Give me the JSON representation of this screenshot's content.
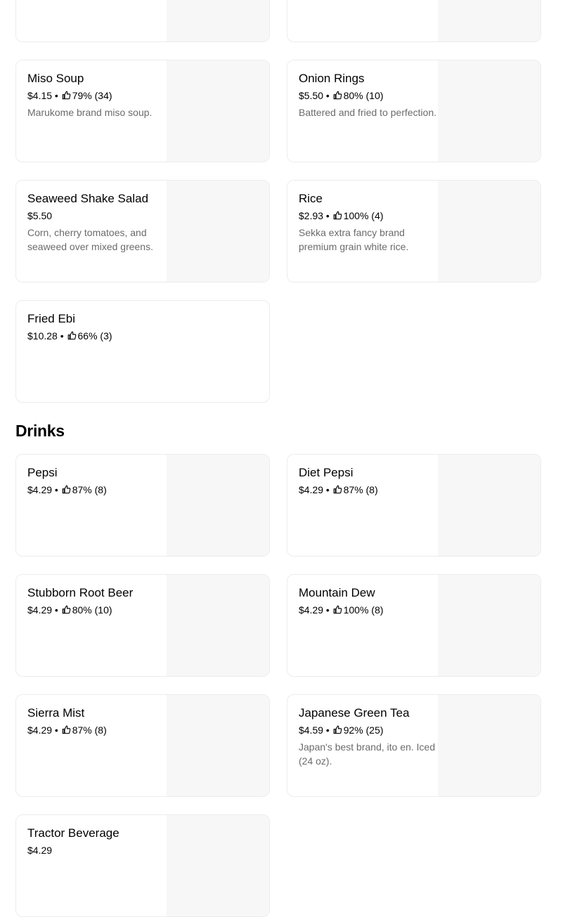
{
  "sections": [
    {
      "title": "",
      "items": [
        {
          "name": "",
          "price": "",
          "rating": "",
          "desc": ""
        },
        {
          "name": "",
          "price": "",
          "rating": "",
          "desc": ""
        },
        {
          "name": "Miso Soup",
          "price": "$4.15",
          "rating": "79% (34)",
          "desc": "Marukome brand miso soup."
        },
        {
          "name": "Onion Rings",
          "price": "$5.50",
          "rating": "80% (10)",
          "desc": "Battered and fried to perfection."
        },
        {
          "name": "Seaweed Shake Salad",
          "price": "$5.50",
          "rating": "",
          "desc": "Corn, cherry tomatoes, and seaweed over mixed greens."
        },
        {
          "name": "Rice",
          "price": "$2.93",
          "rating": "100% (4)",
          "desc": "Sekka extra fancy brand premium grain white rice."
        },
        {
          "name": "Fried Ebi",
          "price": "$10.28",
          "rating": "66% (3)",
          "desc": ""
        }
      ]
    },
    {
      "title": "Drinks",
      "items": [
        {
          "name": "Pepsi",
          "price": "$4.29",
          "rating": "87% (8)",
          "desc": ""
        },
        {
          "name": "Diet Pepsi",
          "price": "$4.29",
          "rating": "87% (8)",
          "desc": ""
        },
        {
          "name": "Stubborn Root Beer",
          "price": "$4.29",
          "rating": "80% (10)",
          "desc": ""
        },
        {
          "name": "Mountain Dew",
          "price": "$4.29",
          "rating": "100% (8)",
          "desc": ""
        },
        {
          "name": "Sierra Mist",
          "price": "$4.29",
          "rating": "87% (8)",
          "desc": ""
        },
        {
          "name": "Japanese Green Tea",
          "price": "$4.59",
          "rating": "92% (25)",
          "desc": "Japan's best brand, ito en. Iced (24 oz)."
        },
        {
          "name": "Tractor Beverage",
          "price": "$4.29",
          "rating": "",
          "desc": ""
        }
      ]
    }
  ],
  "colors": {
    "card_border": "#ececec",
    "thumb_bg": "#f7f7f7",
    "desc_text": "#6b6b6b"
  },
  "icons": {
    "rating": "thumbs-up-icon"
  }
}
